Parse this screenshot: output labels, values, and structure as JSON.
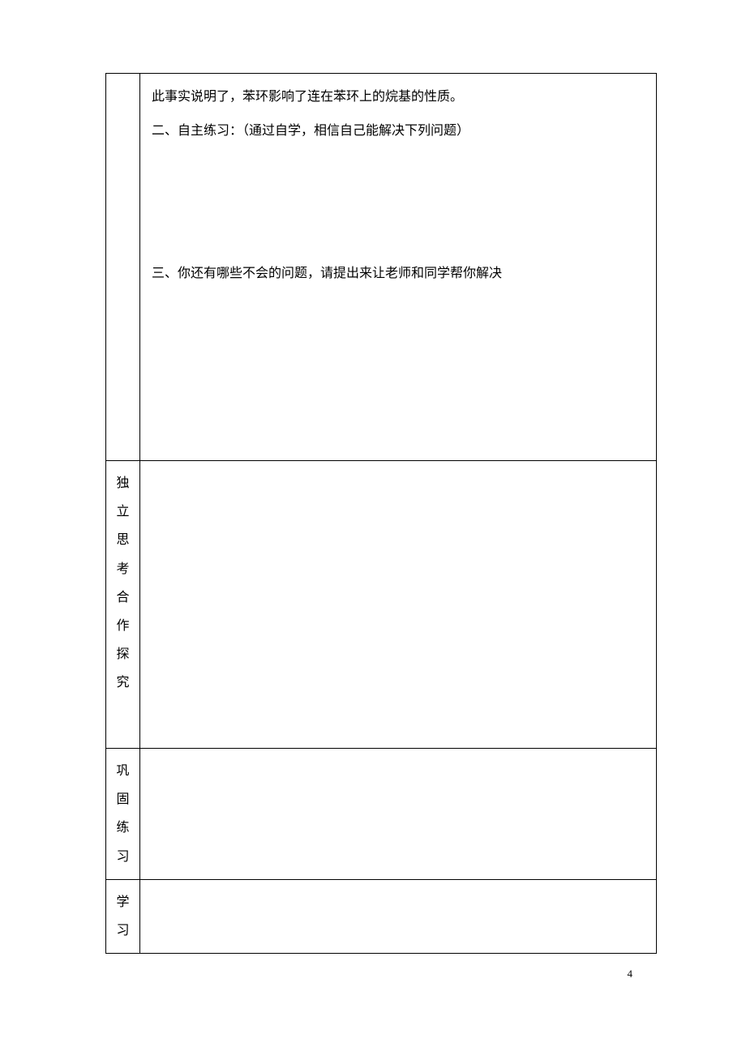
{
  "row1": {
    "label": "",
    "content": {
      "line1": "此事实说明了，苯环影响了连在苯环上的烷基的性质。",
      "line2": "二、自主练习：（通过自学，相信自己能解决下列问题）",
      "line3": "三、你还有哪些不会的问题，请提出来让老师和同学帮你解决"
    }
  },
  "row2": {
    "label_chars": [
      "独",
      "立",
      "思",
      "考",
      "",
      "合",
      "作",
      "探",
      "究"
    ]
  },
  "row3": {
    "label_chars": [
      "巩",
      "固",
      "练",
      "习"
    ]
  },
  "row4": {
    "label_chars": [
      "学",
      "习"
    ]
  },
  "page_number": "4"
}
